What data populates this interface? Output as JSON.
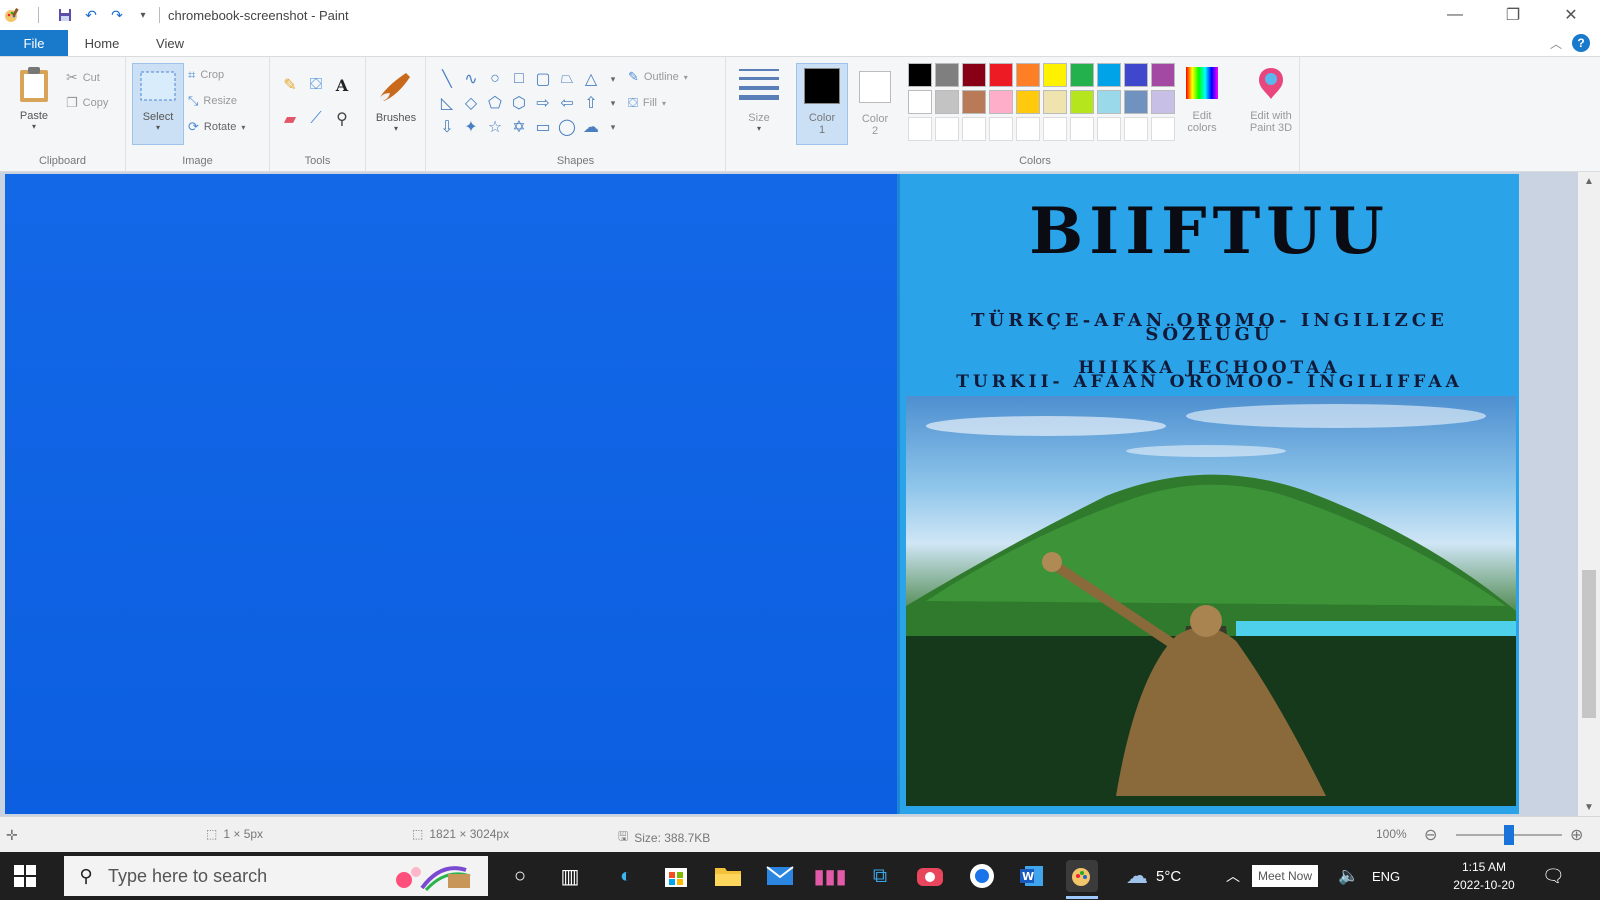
{
  "window": {
    "title": "chromebook-screenshot - Paint",
    "qa_dropdown": "▾"
  },
  "tabs": [
    {
      "label": "File"
    },
    {
      "label": "Home"
    },
    {
      "label": "View"
    }
  ],
  "ribbon": {
    "clipboard": {
      "label": "Clipboard",
      "paste": "Paste",
      "cut": "Cut",
      "copy": "Copy"
    },
    "image": {
      "label": "Image",
      "select": "Select",
      "crop": "Crop",
      "resize": "Resize",
      "rotate": "Rotate"
    },
    "tools": {
      "label": "Tools"
    },
    "brushes": {
      "label": "Brushes"
    },
    "shapes": {
      "label": "Shapes",
      "outline": "Outline",
      "fill": "Fill"
    },
    "size": {
      "label": "Size"
    },
    "color1": {
      "label_line1": "Color",
      "label_line2": "1",
      "color": "#000000"
    },
    "color2": {
      "label_line1": "Color",
      "label_line2": "2",
      "color": "#ffffff"
    },
    "colors": {
      "label": "Colors",
      "row1": [
        "#000000",
        "#7f7f7f",
        "#880015",
        "#ed1c24",
        "#ff7f27",
        "#fff200",
        "#22b14c",
        "#00a2e8",
        "#3f48cc",
        "#a349a4"
      ],
      "row2": [
        "#ffffff",
        "#c3c3c3",
        "#b97a57",
        "#ffaec9",
        "#ffc90e",
        "#efe4b0",
        "#b5e61d",
        "#99d9ea",
        "#7092be",
        "#c8bfe7"
      ],
      "row3": [
        "#ffffff",
        "#ffffff",
        "#ffffff",
        "#ffffff",
        "#ffffff",
        "#ffffff",
        "#ffffff",
        "#ffffff",
        "#ffffff",
        "#ffffff"
      ]
    },
    "edit_colors": {
      "line1": "Edit",
      "line2": "colors"
    },
    "paint3d": {
      "line1": "Edit with",
      "line2": "Paint 3D"
    }
  },
  "canvas": {
    "cover_title": "BIIFTUU",
    "cover_sub1": "TÜRKÇE-AFAN OROMO- INGILIZCE",
    "cover_sub2": "SÖZLÜGÜ",
    "cover_sub3": "HIIKKA JECHOOTAA",
    "cover_sub4": "TURKII- AFAAN OROMOO- INGILIFFAA"
  },
  "status": {
    "cursor": "1 × 5px",
    "dimensions": "1821 × 3024px",
    "size": "Size: 388.7KB",
    "zoom": "100%",
    "zoom_level_fraction": 0.5
  },
  "taskbar": {
    "search_placeholder": "Type here to search",
    "weather": "5°C",
    "meet_now": "Meet Now",
    "language": "ENG",
    "time": "1:15 AM",
    "date": "2022-10-20"
  }
}
